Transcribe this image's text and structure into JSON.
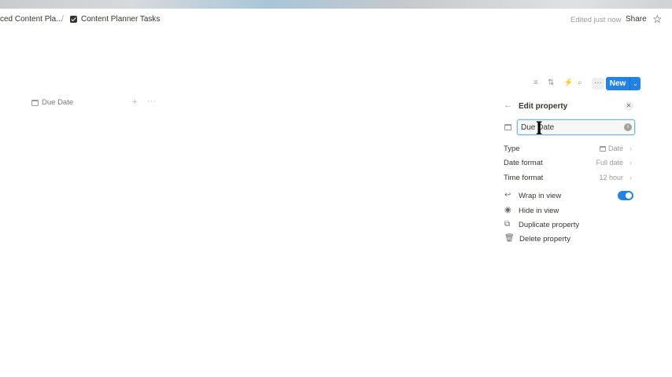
{
  "breadcrumb": {
    "parent": "ced Content Pla...",
    "separator": "/",
    "current": "Content Planner Tasks"
  },
  "header": {
    "edited_status": "Edited just now",
    "share_label": "Share"
  },
  "toolbar": {
    "new_label": "New",
    "icons": [
      "filter-icon",
      "sort-icon",
      "automation-icon",
      "search-icon",
      "more-icon",
      "chevron-down-icon"
    ]
  },
  "table": {
    "column_label": "Due Date"
  },
  "edit_property": {
    "title": "Edit property",
    "name_value": "Due Date",
    "type_label": "Type",
    "type_value": "Date",
    "date_format_label": "Date format",
    "date_format_value": "Full date",
    "time_format_label": "Time format",
    "time_format_value": "12 hour",
    "options": {
      "wrap": "Wrap in view",
      "hide": "Hide in view",
      "duplicate": "Duplicate property",
      "delete": "Delete property"
    },
    "wrap_enabled": true
  },
  "colors": {
    "accent": "#2383e2",
    "text": "#37352f",
    "muted": "#9b9a97"
  }
}
